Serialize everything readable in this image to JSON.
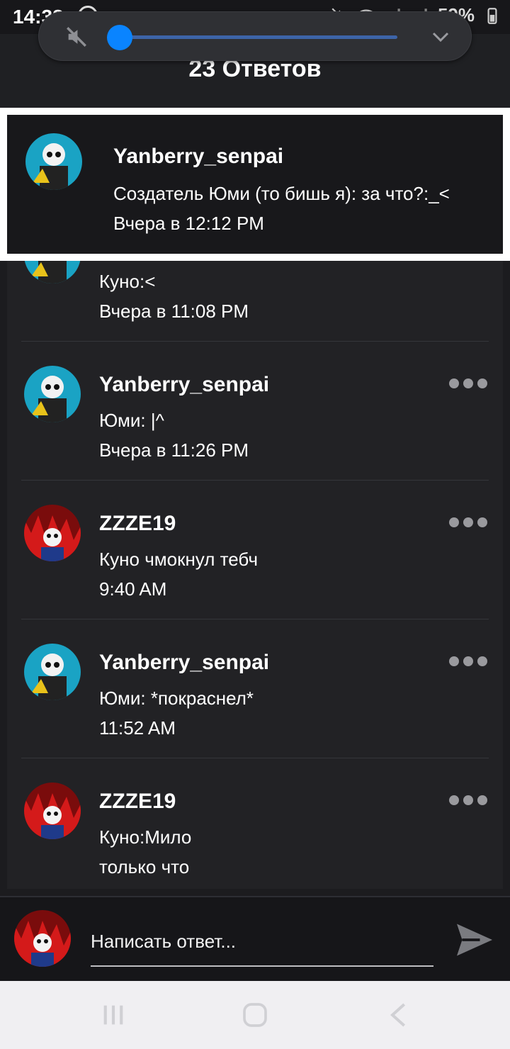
{
  "status_bar": {
    "time": "14:38",
    "battery": "59%"
  },
  "header": {
    "title": "23 Ответов"
  },
  "volume": {
    "level": 0.0
  },
  "parent_reply": {
    "username": "Yanberry_senpai",
    "message": "Создатель Юми (то бишь я): за что?:_<",
    "time": "Вчера в 12:12 PM"
  },
  "replies": [
    {
      "username": "",
      "message": "Куно:<",
      "time": "Вчера в 11:08 PM",
      "avatar": "yanberry"
    },
    {
      "username": "Yanberry_senpai",
      "message": "Юми: |^",
      "time": "Вчера в 11:26 PM",
      "avatar": "yanberry"
    },
    {
      "username": "ZZZE19",
      "message": "Куно чмокнул тебч",
      "time": "9:40 AM",
      "avatar": "zzze"
    },
    {
      "username": "Yanberry_senpai",
      "message": "Юми: *покраснел*",
      "time": "11:52 AM",
      "avatar": "yanberry"
    },
    {
      "username": "ZZZE19",
      "message": "Куно:Мило",
      "time": "только что",
      "avatar": "zzze"
    }
  ],
  "composer": {
    "placeholder": "Написать ответ..."
  },
  "icons": {
    "mute": "volume-mute-icon",
    "chevron": "chevron-down-icon",
    "more": "more-dots-icon",
    "send": "send-icon",
    "nav_recents": "recents-icon",
    "nav_home": "home-icon",
    "nav_back": "back-icon"
  },
  "colors": {
    "accent": "#0a84ff",
    "background": "#222225",
    "highlight_border": "#ffffff"
  }
}
